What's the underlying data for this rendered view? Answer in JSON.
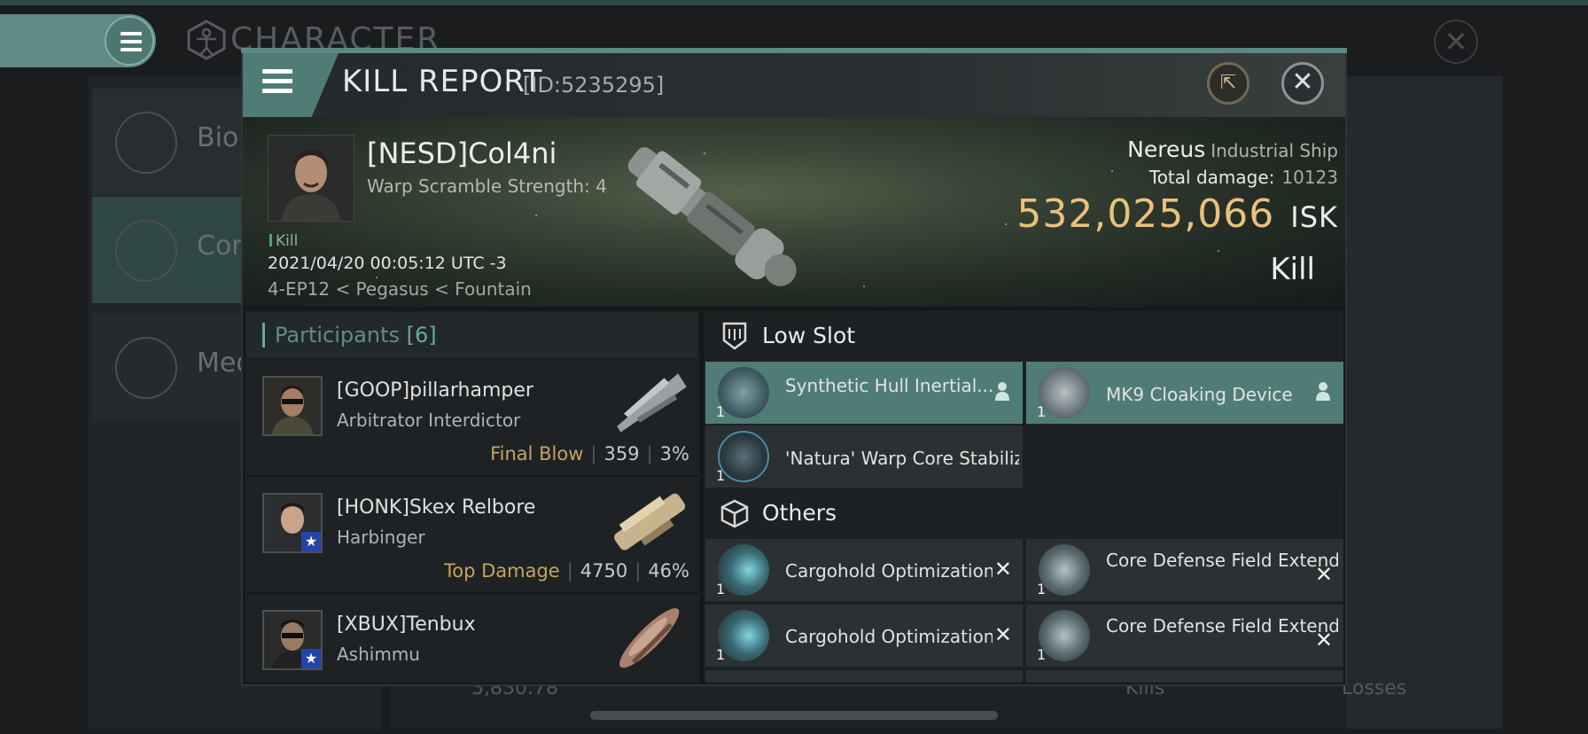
{
  "background": {
    "title": "CHARACTER",
    "sidebar": [
      {
        "label": "Bio"
      },
      {
        "label": "Con"
      },
      {
        "label": "Med"
      }
    ],
    "stat_value": "3,830.78",
    "tab_kills": "Kills",
    "tab_losses": "Losses"
  },
  "report": {
    "title": "KILL REPORT",
    "id": "[ID:5235295]",
    "victim": {
      "name": "[NESD]Col4ni",
      "warp": "Warp Scramble Strength: 4",
      "tag": "Kill",
      "datetime": "2021/04/20 00:05:12 UTC -3",
      "location": "4-EP12 < Pegasus < Fountain"
    },
    "ship": {
      "name": "Nereus",
      "class": "Industrial Ship",
      "damage_label": "Total damage:",
      "damage_value": "10123",
      "isk_value": "532,025,066",
      "isk_unit": "ISK",
      "result": "Kill"
    }
  },
  "participants": {
    "label": "Participants",
    "count": "[6]",
    "rows": [
      {
        "name": "[GOOP]pillarhamper",
        "ship": "Arbitrator Interdictor",
        "label": "Final Blow",
        "damage": "359",
        "percent": "3%"
      },
      {
        "name": "[HONK]Skex Relbore",
        "ship": "Harbinger",
        "label": "Top Damage",
        "damage": "4750",
        "percent": "46%"
      },
      {
        "name": "[XBUX]Tenbux",
        "ship": "Ashimmu",
        "label": "",
        "damage": "",
        "percent": ""
      }
    ]
  },
  "slots": {
    "low_title": "Low Slot",
    "low_items": [
      {
        "name": "Synthetic Hull Inertial...",
        "qty": "1"
      },
      {
        "name": "MK9 Cloaking Device",
        "qty": "1"
      },
      {
        "name": "'Natura' Warp Core Stabilizer",
        "qty": "1"
      }
    ],
    "others_title": "Others",
    "other_items": [
      {
        "name": "Cargohold Optimization III",
        "qty": "1"
      },
      {
        "name": "Core Defense Field Extende...",
        "qty": "1"
      },
      {
        "name": "Cargohold Optimization III",
        "qty": "1"
      },
      {
        "name": "Core Defense Field Extende...",
        "qty": "1"
      }
    ]
  },
  "colors": {
    "accent_teal": "#507c77",
    "isk_gold": "#e8c27e",
    "label_gold": "#c7a35f"
  }
}
